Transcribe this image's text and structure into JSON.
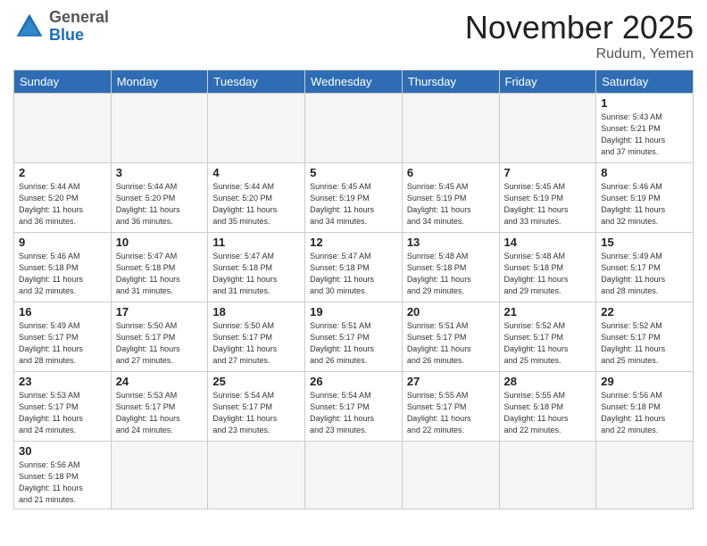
{
  "header": {
    "logo_general": "General",
    "logo_blue": "Blue",
    "month_title": "November 2025",
    "location": "Rudum, Yemen"
  },
  "weekdays": [
    "Sunday",
    "Monday",
    "Tuesday",
    "Wednesday",
    "Thursday",
    "Friday",
    "Saturday"
  ],
  "days": [
    {
      "num": "",
      "sunrise": "",
      "sunset": "",
      "daylight": "",
      "empty": true
    },
    {
      "num": "",
      "sunrise": "",
      "sunset": "",
      "daylight": "",
      "empty": true
    },
    {
      "num": "",
      "sunrise": "",
      "sunset": "",
      "daylight": "",
      "empty": true
    },
    {
      "num": "",
      "sunrise": "",
      "sunset": "",
      "daylight": "",
      "empty": true
    },
    {
      "num": "",
      "sunrise": "",
      "sunset": "",
      "daylight": "",
      "empty": true
    },
    {
      "num": "",
      "sunrise": "",
      "sunset": "",
      "daylight": "",
      "empty": true
    },
    {
      "num": "1",
      "info": "Sunrise: 5:43 AM\nSunset: 5:21 PM\nDaylight: 11 hours\nand 37 minutes.",
      "empty": false
    },
    {
      "num": "2",
      "info": "Sunrise: 5:44 AM\nSunset: 5:20 PM\nDaylight: 11 hours\nand 36 minutes.",
      "empty": false
    },
    {
      "num": "3",
      "info": "Sunrise: 5:44 AM\nSunset: 5:20 PM\nDaylight: 11 hours\nand 36 minutes.",
      "empty": false
    },
    {
      "num": "4",
      "info": "Sunrise: 5:44 AM\nSunset: 5:20 PM\nDaylight: 11 hours\nand 35 minutes.",
      "empty": false
    },
    {
      "num": "5",
      "info": "Sunrise: 5:45 AM\nSunset: 5:19 PM\nDaylight: 11 hours\nand 34 minutes.",
      "empty": false
    },
    {
      "num": "6",
      "info": "Sunrise: 5:45 AM\nSunset: 5:19 PM\nDaylight: 11 hours\nand 34 minutes.",
      "empty": false
    },
    {
      "num": "7",
      "info": "Sunrise: 5:45 AM\nSunset: 5:19 PM\nDaylight: 11 hours\nand 33 minutes.",
      "empty": false
    },
    {
      "num": "8",
      "info": "Sunrise: 5:46 AM\nSunset: 5:19 PM\nDaylight: 11 hours\nand 32 minutes.",
      "empty": false
    },
    {
      "num": "9",
      "info": "Sunrise: 5:46 AM\nSunset: 5:18 PM\nDaylight: 11 hours\nand 32 minutes.",
      "empty": false
    },
    {
      "num": "10",
      "info": "Sunrise: 5:47 AM\nSunset: 5:18 PM\nDaylight: 11 hours\nand 31 minutes.",
      "empty": false
    },
    {
      "num": "11",
      "info": "Sunrise: 5:47 AM\nSunset: 5:18 PM\nDaylight: 11 hours\nand 31 minutes.",
      "empty": false
    },
    {
      "num": "12",
      "info": "Sunrise: 5:47 AM\nSunset: 5:18 PM\nDaylight: 11 hours\nand 30 minutes.",
      "empty": false
    },
    {
      "num": "13",
      "info": "Sunrise: 5:48 AM\nSunset: 5:18 PM\nDaylight: 11 hours\nand 29 minutes.",
      "empty": false
    },
    {
      "num": "14",
      "info": "Sunrise: 5:48 AM\nSunset: 5:18 PM\nDaylight: 11 hours\nand 29 minutes.",
      "empty": false
    },
    {
      "num": "15",
      "info": "Sunrise: 5:49 AM\nSunset: 5:17 PM\nDaylight: 11 hours\nand 28 minutes.",
      "empty": false
    },
    {
      "num": "16",
      "info": "Sunrise: 5:49 AM\nSunset: 5:17 PM\nDaylight: 11 hours\nand 28 minutes.",
      "empty": false
    },
    {
      "num": "17",
      "info": "Sunrise: 5:50 AM\nSunset: 5:17 PM\nDaylight: 11 hours\nand 27 minutes.",
      "empty": false
    },
    {
      "num": "18",
      "info": "Sunrise: 5:50 AM\nSunset: 5:17 PM\nDaylight: 11 hours\nand 27 minutes.",
      "empty": false
    },
    {
      "num": "19",
      "info": "Sunrise: 5:51 AM\nSunset: 5:17 PM\nDaylight: 11 hours\nand 26 minutes.",
      "empty": false
    },
    {
      "num": "20",
      "info": "Sunrise: 5:51 AM\nSunset: 5:17 PM\nDaylight: 11 hours\nand 26 minutes.",
      "empty": false
    },
    {
      "num": "21",
      "info": "Sunrise: 5:52 AM\nSunset: 5:17 PM\nDaylight: 11 hours\nand 25 minutes.",
      "empty": false
    },
    {
      "num": "22",
      "info": "Sunrise: 5:52 AM\nSunset: 5:17 PM\nDaylight: 11 hours\nand 25 minutes.",
      "empty": false
    },
    {
      "num": "23",
      "info": "Sunrise: 5:53 AM\nSunset: 5:17 PM\nDaylight: 11 hours\nand 24 minutes.",
      "empty": false
    },
    {
      "num": "24",
      "info": "Sunrise: 5:53 AM\nSunset: 5:17 PM\nDaylight: 11 hours\nand 24 minutes.",
      "empty": false
    },
    {
      "num": "25",
      "info": "Sunrise: 5:54 AM\nSunset: 5:17 PM\nDaylight: 11 hours\nand 23 minutes.",
      "empty": false
    },
    {
      "num": "26",
      "info": "Sunrise: 5:54 AM\nSunset: 5:17 PM\nDaylight: 11 hours\nand 23 minutes.",
      "empty": false
    },
    {
      "num": "27",
      "info": "Sunrise: 5:55 AM\nSunset: 5:17 PM\nDaylight: 11 hours\nand 22 minutes.",
      "empty": false
    },
    {
      "num": "28",
      "info": "Sunrise: 5:55 AM\nSunset: 5:18 PM\nDaylight: 11 hours\nand 22 minutes.",
      "empty": false
    },
    {
      "num": "29",
      "info": "Sunrise: 5:56 AM\nSunset: 5:18 PM\nDaylight: 11 hours\nand 22 minutes.",
      "empty": false
    },
    {
      "num": "30",
      "info": "Sunrise: 5:56 AM\nSunset: 5:18 PM\nDaylight: 11 hours\nand 21 minutes.",
      "empty": false
    }
  ]
}
